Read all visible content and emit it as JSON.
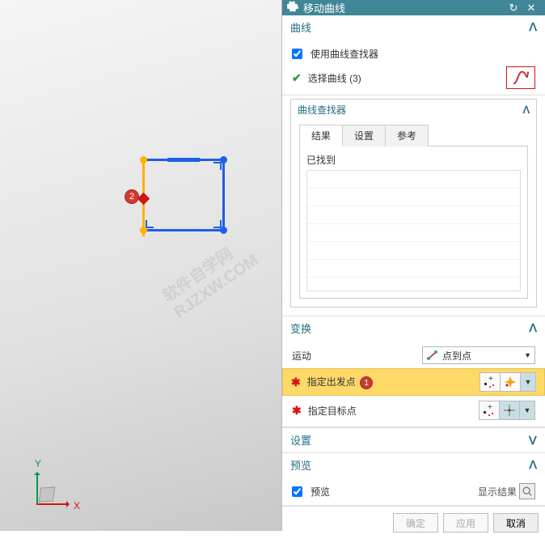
{
  "titlebar": {
    "title": "移动曲线"
  },
  "viewport": {
    "callout_2": "2",
    "axis_x": "X",
    "axis_y": "Y"
  },
  "sections": {
    "curve": {
      "header": "曲线",
      "use_finder": "使用曲线查找器",
      "select_label": "选择曲线 (3)"
    },
    "finder": {
      "header": "曲线查找器",
      "tabs": {
        "results": "结果",
        "settings": "设置",
        "reference": "参考"
      },
      "found_label": "已找到"
    },
    "transform": {
      "header": "变换",
      "motion_label": "运动",
      "motion_value": "点到点",
      "specify_start": "指定出发点",
      "start_badge": "1",
      "specify_target": "指定目标点"
    },
    "settings": {
      "header": "设置"
    },
    "preview": {
      "header": "预览",
      "checkbox_label": "预览",
      "show_result": "显示结果"
    }
  },
  "footer": {
    "ok": "确定",
    "apply": "应用",
    "cancel": "取消"
  },
  "icons": {
    "gear": "gear-icon",
    "undo": "undo-icon",
    "close": "close-icon",
    "chevron": "chevron-up-icon",
    "curve": "s-curve-icon",
    "point": "point-to-point-icon",
    "pick1": "pick-plus-icon",
    "spark": "spark-icon",
    "pick2": "pick-dots-icon",
    "cross": "crosshair-icon",
    "magnifier": "magnifier-icon"
  }
}
